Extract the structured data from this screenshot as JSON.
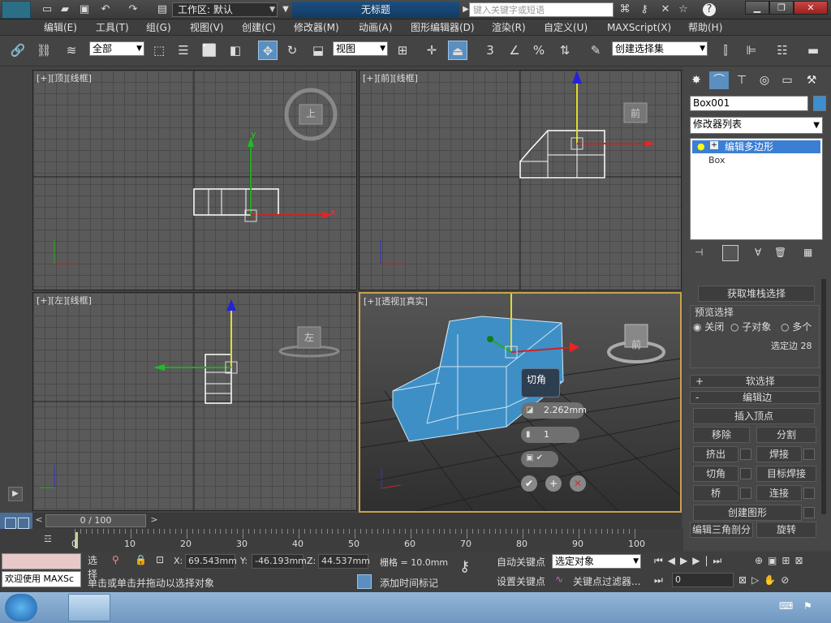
{
  "titlebar": {
    "workspace_label": "工作区: 默认",
    "doc_title": "无标题",
    "search_placeholder": "键入关键字或短语"
  },
  "menu": [
    "编辑(E)",
    "工具(T)",
    "组(G)",
    "视图(V)",
    "创建(C)",
    "修改器(M)",
    "动画(A)",
    "图形编辑器(D)",
    "渲染(R)",
    "自定义(U)",
    "MAXScript(X)",
    "帮助(H)"
  ],
  "toolbar": {
    "filter": "全部",
    "ref_coord": "视图",
    "snap_labels": [
      "3",
      "%"
    ],
    "selection_set": "创建选择集"
  },
  "viewports": {
    "top": {
      "label": "[+][顶][线框]",
      "cube_label": "上",
      "axis": {
        "x": "x",
        "y": "y"
      }
    },
    "front": {
      "label": "[+][前][线框]",
      "cube_label": "前"
    },
    "left": {
      "label": "[+][左][线框]",
      "cube_label": "左"
    },
    "persp": {
      "label": "[+][透视][真实]",
      "cube_label": "前"
    }
  },
  "caddy": {
    "title": "切角",
    "amount": "2.262mm",
    "segments": "1"
  },
  "command_panel": {
    "object_name": "Box001",
    "modifier_list": "修改器列表",
    "stack": [
      "编辑多边形",
      "Box"
    ],
    "get_stack_selection": "获取堆栈选择",
    "preview_title": "预览选择",
    "preview_options": [
      "关闭",
      "子对象",
      "多个"
    ],
    "selected_edges": "选定边 28",
    "soft_selection": "软选择",
    "edit_edges": "编辑边",
    "insert_vertex": "插入顶点",
    "buttons": [
      [
        "移除",
        "分割"
      ],
      [
        "挤出",
        "焊接"
      ],
      [
        "切角",
        "目标焊接"
      ],
      [
        "桥",
        "连接"
      ]
    ],
    "create_shape": "创建图形",
    "edit_tri": "编辑三角剖分",
    "turn": "旋转"
  },
  "timeline": {
    "frame_counter": "0 / 100",
    "ticks": [
      "0",
      "10",
      "20",
      "30",
      "40",
      "50",
      "60",
      "70",
      "80",
      "90",
      "100"
    ]
  },
  "status": {
    "welcome": "欢迎使用 MAXSc",
    "select_label": "选择",
    "x_label": "X:",
    "x": "69.543mm",
    "y_label": "Y:",
    "y": "-46.193mm",
    "z_label": "Z:",
    "z": "44.537mm",
    "grid": "栅格 = 10.0mm",
    "auto_key": "自动关键点",
    "selected_object": "选定对象",
    "set_key": "设置关键点",
    "key_filters": "关键点过滤器...",
    "prompt": "单击或单击并拖动以选择对象",
    "add_time_tag": "添加时间标记",
    "frame_value": "0"
  },
  "colors": {
    "accent_blue": "#4a9ad0",
    "active_border": "#c9a24b",
    "taskbar": "#7aa2cc"
  }
}
